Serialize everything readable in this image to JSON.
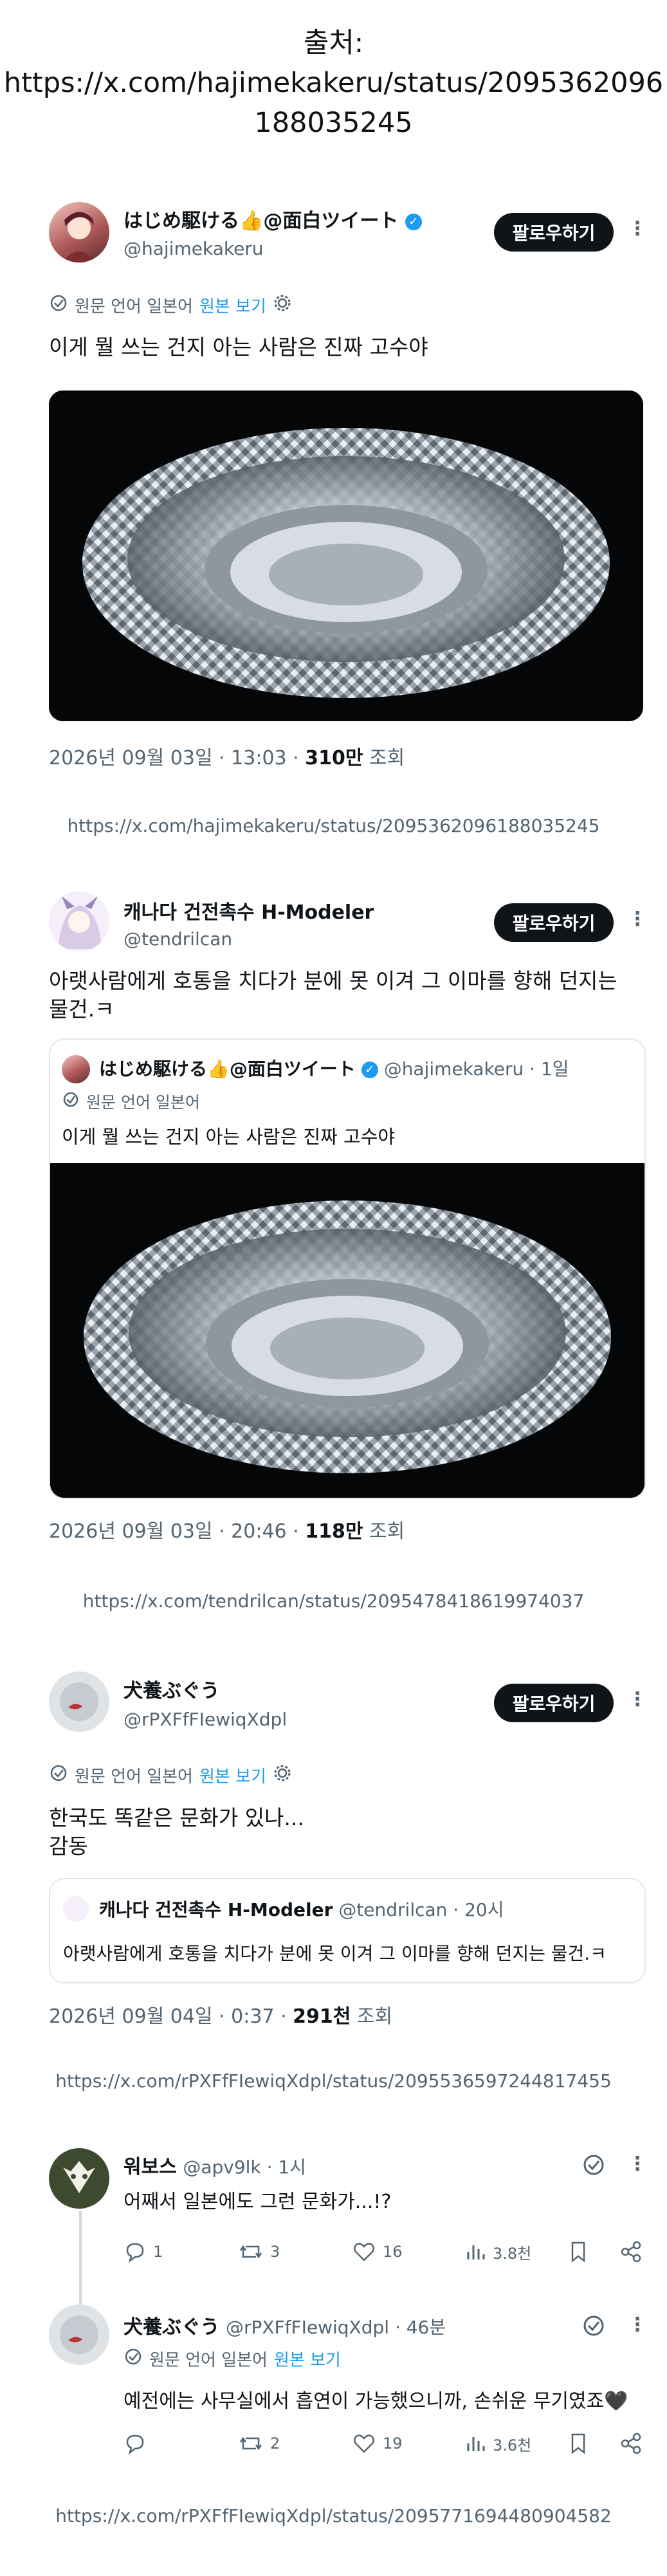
{
  "source": {
    "label": "출처:",
    "url_line1": "https://x.com/hajimekakeru/status/2095362096",
    "url_line2": "188035245"
  },
  "post1": {
    "name": "はじめ駆ける👍@面白ツイート",
    "handle": "@hajimekakeru",
    "follow_label": "팔로우하기",
    "translate_note": "원문 언어 일본어",
    "show_original": "원본 보기",
    "text": "이게 뭘 쓰는 건지 아는 사람은 진짜 고수야",
    "timestamp": "2026년 09월 03일 · 13:03 · ",
    "views": "310만",
    "views_label": " 조회",
    "url": "https://x.com/hajimekakeru/status/2095362096188035245"
  },
  "post2": {
    "name": "캐나다 건전촉수 H-Modeler",
    "handle": "@tendrilcan",
    "follow_label": "팔로우하기",
    "text_line1": "아랫사람에게 호통을 치다가 분에 못 이겨 그 이마를 향해 던지는",
    "text_line2": "물건.ㅋ",
    "quote": {
      "name": "はじめ駆ける👍@面白ツイート",
      "handle_time": "@hajimekakeru · 1일",
      "translate_note": "원문 언어 일본어",
      "text": "이게 뭘 쓰는 건지 아는 사람은 진짜 고수야"
    },
    "timestamp": "2026년 09월 03일 · 20:46 · ",
    "views": "118만",
    "views_label": " 조회",
    "url": "https://x.com/tendrilcan/status/2095478418619974037"
  },
  "post3": {
    "name": "犬養ぶぐう",
    "handle": "@rPXFfFIewiqXdpl",
    "follow_label": "팔로우하기",
    "translate_note": "원문 언어 일본어",
    "show_original": "원본 보기",
    "text_line1": "한국도 똑같은 문화가 있나...",
    "text_line2": "감동",
    "quote": {
      "name": "캐나다 건전촉수 H-Modeler",
      "handle_time": "@tendrilcan · 20시",
      "text": "아랫사람에게 호통을 치다가 분에 못 이겨 그 이마를 향해 던지는 물건.ㅋ"
    },
    "timestamp": "2026년 09월 04일 · 0:37 · ",
    "views": "291천",
    "views_label": " 조회",
    "url": "https://x.com/rPXFfFIewiqXdpl/status/2095536597244817455"
  },
  "reply1": {
    "name": "워보스",
    "handle_time": "@apv9lk · 1시",
    "text": "어째서 일본에도 그런 문화가...!?",
    "replies": "1",
    "retweets": "3",
    "likes": "16",
    "views": "3.8천"
  },
  "reply2": {
    "name": "犬養ぶぐう",
    "handle_time": "@rPXFfFIewiqXdpl · 46분",
    "translate_note": "원문 언어 일본어",
    "show_original": "원본 보기",
    "text": "예전에는 사무실에서 흡연이 가능했으니까, 손쉬운 무기였죠🖤",
    "replies": "",
    "retweets": "2",
    "likes": "19",
    "views": "3.6천"
  },
  "footer_url": "https://x.com/rPXFfFIewiqXdpl/status/2095771694480904582",
  "icons": {
    "verified": "verified-badge-icon",
    "translate": "translate-icon",
    "settings": "gear-icon",
    "more": "more-dots-icon"
  },
  "colors": {
    "accent": "#1d9bf0",
    "text": "#0f1419",
    "muted": "#536471"
  }
}
